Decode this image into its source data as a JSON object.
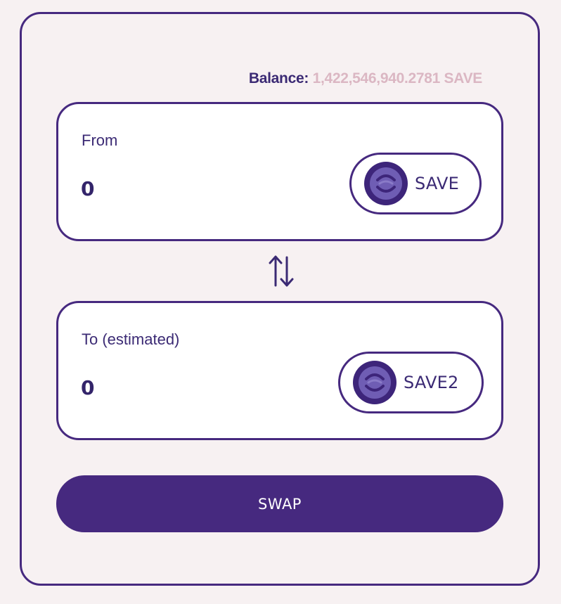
{
  "balance": {
    "label": "Balance:",
    "value": "1,422,546,940.2781 SAVE"
  },
  "from": {
    "label": "From",
    "amount": "0",
    "token": "SAVE",
    "token_icon": "save-token-icon"
  },
  "to": {
    "label": "To (estimated)",
    "amount": "0",
    "token": "SAVE2",
    "token_icon": "save-token-icon"
  },
  "switch_icon": "swap-arrows-icon",
  "swap_button": {
    "label": "SWAP"
  },
  "colors": {
    "primary": "#46297f",
    "text": "#3b2a74",
    "balance_value": "#dbb7c3",
    "background": "#f7f1f2",
    "card": "#ffffff"
  }
}
